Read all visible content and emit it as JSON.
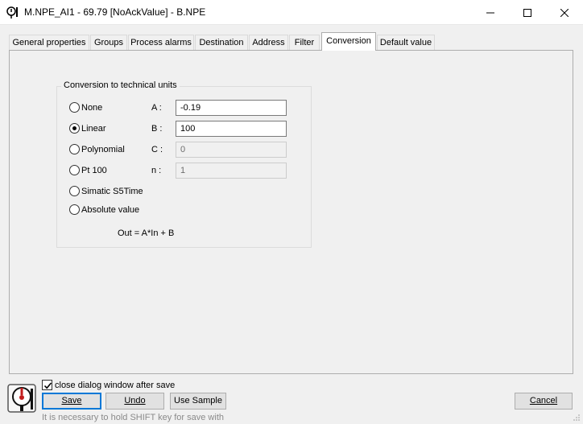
{
  "window": {
    "title": "M.NPE_AI1 - 69.79 [NoAckValue] - B.NPE"
  },
  "tabs": [
    {
      "label": "General properties"
    },
    {
      "label": "Groups"
    },
    {
      "label": "Process alarms"
    },
    {
      "label": "Destination"
    },
    {
      "label": "Address"
    },
    {
      "label": "Filter"
    },
    {
      "label": "Conversion",
      "active": true
    },
    {
      "label": "Default value"
    }
  ],
  "conversion": {
    "group_title": "Conversion to technical units",
    "options": [
      {
        "label": "None",
        "checked": false
      },
      {
        "label": "Linear",
        "checked": true
      },
      {
        "label": "Polynomial",
        "checked": false
      },
      {
        "label": "Pt 100",
        "checked": false
      },
      {
        "label": "Simatic S5Time",
        "checked": false
      },
      {
        "label": "Absolute value",
        "checked": false
      }
    ],
    "fields": {
      "a_label": "A :",
      "a_value": "-0.19",
      "b_label": "B :",
      "b_value": "100",
      "c_label": "C :",
      "c_value": "0",
      "n_label": "n :",
      "n_value": "1"
    },
    "formula": "Out = A*In + B"
  },
  "footer": {
    "close_after_save_label": "close dialog window after save",
    "close_after_save_checked": true,
    "save_label": "Save",
    "undo_label": "Undo",
    "use_sample_label": "Use Sample",
    "cancel_label": "Cancel",
    "hint": "It is necessary to hold SHIFT key for save with"
  },
  "colors": {
    "accent": "#0078d7",
    "dialog_bg": "#f0f0f0",
    "button_bg": "#e1e1e1"
  }
}
